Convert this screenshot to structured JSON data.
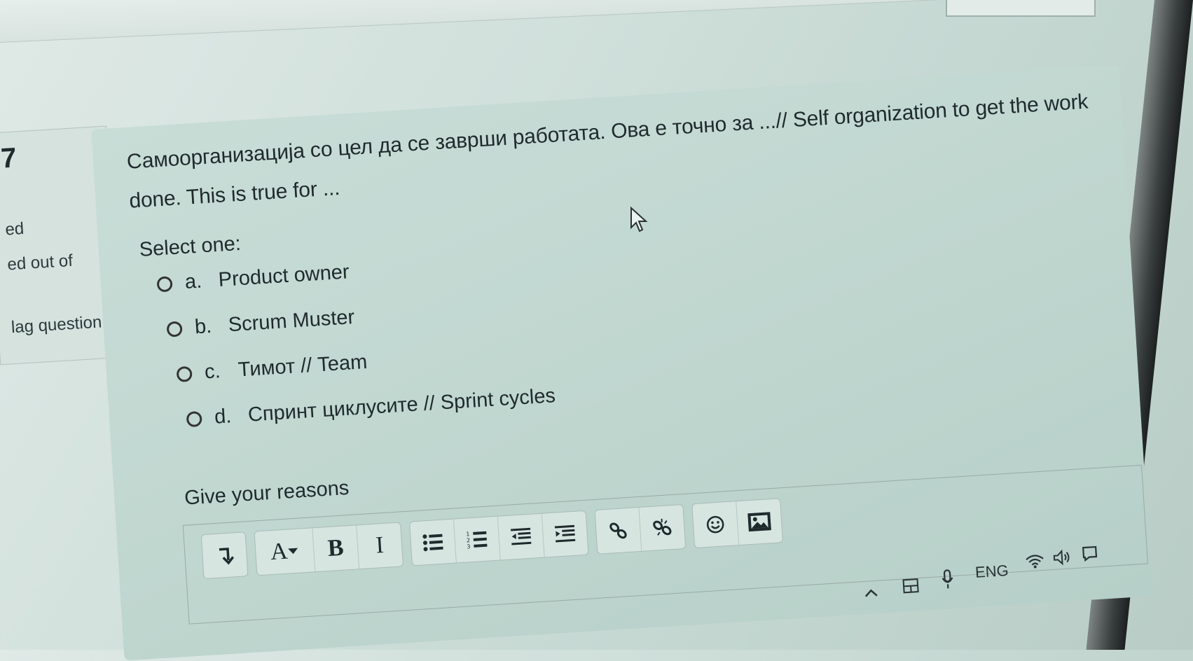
{
  "question": {
    "number": "7",
    "status_partial": "ed",
    "marks_partial": "ed out of",
    "flag_partial": "lag question",
    "text": "Самоорганизација со цел да се заврши работата. Ова е точно за ...// Self organization to get the work done. This is true for ...",
    "select_label": "Select one:",
    "answers": [
      {
        "letter": "a.",
        "text": "Product owner"
      },
      {
        "letter": "b.",
        "text": "Scrum Muster"
      },
      {
        "letter": "c.",
        "text": "Тимот // Team"
      },
      {
        "letter": "d.",
        "text": "Спринт циклусите // Sprint cycles"
      }
    ]
  },
  "reasons": {
    "label": "Give your reasons",
    "toolbar": {
      "expand_icon": "expand-icon",
      "font_label": "A",
      "bold_label": "B",
      "italic_label": "I",
      "buttons": [
        "unordered-list-icon",
        "ordered-list-icon",
        "outdent-icon",
        "indent-icon",
        "link-icon",
        "unlink-icon",
        "emoji-icon",
        "image-icon"
      ]
    }
  },
  "taskbar": {
    "language": "ENG",
    "icons": [
      "chevron-up-icon",
      "touch-keyboard-icon",
      "microphone-icon",
      "wifi-icon",
      "volume-icon",
      "notification-icon"
    ]
  }
}
